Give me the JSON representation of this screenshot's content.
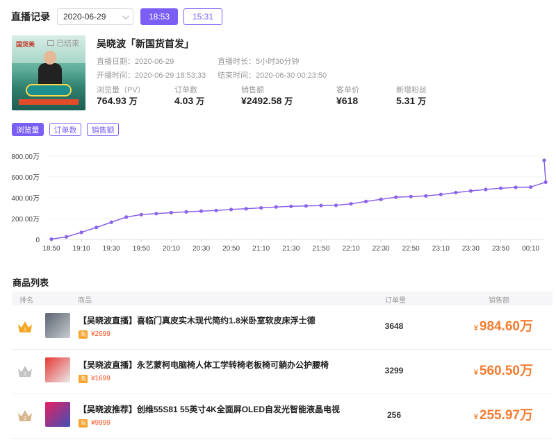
{
  "header": {
    "title": "直播记录",
    "date_value": "2020-06-29",
    "time_buttons": [
      "18:53",
      "15:31"
    ]
  },
  "live": {
    "ended_label": "已结束",
    "cover_text": "国货美",
    "title": "吴晓波「新国货首发」",
    "live_date_label": "直播日期：",
    "live_date": "2020-06-29",
    "duration_label": "直播时长：",
    "duration": "5小时30分钟",
    "start_label": "开播时间：",
    "start_time": "2020-06-29 18:53:33",
    "end_label": "结束时间：",
    "end_time": "2020-06-30 00:23:50",
    "stats": [
      {
        "label": "浏览量（PV）",
        "value": "764.93",
        "unit": "万"
      },
      {
        "label": "订单数",
        "value": "4.03",
        "unit": "万"
      },
      {
        "label": "销售额",
        "value": "¥2492.58",
        "unit": "万"
      },
      {
        "label": "客单价",
        "value": "¥618",
        "unit": ""
      },
      {
        "label": "新增粉丝",
        "value": "5.31",
        "unit": "万"
      }
    ]
  },
  "tabs": [
    "浏览量",
    "订单数",
    "销售额"
  ],
  "chart_data": {
    "type": "line",
    "color": "#8a63e8",
    "x_ticks": [
      "18:50",
      "19:10",
      "19:30",
      "19:50",
      "20:10",
      "20:30",
      "20:50",
      "21:10",
      "21:30",
      "21:50",
      "22:10",
      "22:30",
      "22:50",
      "23:10",
      "23:30",
      "23:50",
      "00:10"
    ],
    "y_ticks": [
      "0",
      "200.00万",
      "400.00万",
      "600.00万",
      "800.00万"
    ],
    "ylim": [
      0,
      800
    ],
    "y_unit": "万",
    "points_minutes": [
      0,
      10,
      20,
      30,
      40,
      50,
      60,
      70,
      80,
      90,
      100,
      110,
      120,
      130,
      140,
      150,
      160,
      170,
      180,
      190,
      200,
      210,
      220,
      230,
      240,
      250,
      260,
      270,
      280,
      290,
      300,
      310,
      320,
      330
    ],
    "values": [
      3,
      25,
      68,
      115,
      165,
      215,
      238,
      248,
      257,
      265,
      272,
      278,
      288,
      295,
      303,
      312,
      318,
      322,
      326,
      328,
      342,
      365,
      385,
      406,
      412,
      418,
      432,
      450,
      466,
      480,
      492,
      500,
      503,
      550,
      760
    ]
  },
  "products": {
    "title": "商品列表",
    "headers": {
      "rank": "排名",
      "product": "商品",
      "orders": "订单量",
      "sales": "销售额"
    },
    "rows": [
      {
        "name": "【吴晓波直播】喜临门真皮实木现代简约1.8米卧室软皮床浮士德",
        "tag": "淘",
        "price": "¥2699",
        "orders": "3648",
        "sales_symbol": "¥",
        "sales": "984.60万",
        "crown_color": "#f5a623"
      },
      {
        "name": "【吴晓波直播】永艺蒙柯电脑椅人体工学转椅老板椅可躺办公护腰椅",
        "tag": "淘",
        "price": "¥1699",
        "orders": "3299",
        "sales_symbol": "¥",
        "sales": "560.50万",
        "crown_color": "#c4c4c4"
      },
      {
        "name": "【吴晓波推荐】创维55S81 55英寸4K全面屏OLED自发光智能液晶电视",
        "tag": "淘",
        "price": "¥9999",
        "orders": "256",
        "sales_symbol": "¥",
        "sales": "255.97万",
        "crown_color": "#d6b58a"
      }
    ]
  }
}
